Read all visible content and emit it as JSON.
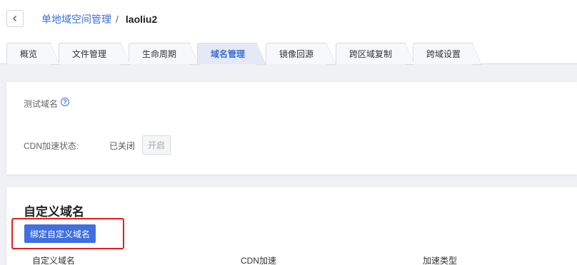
{
  "breadcrumb": {
    "parent": "单地域空间管理",
    "separator": "/",
    "current": "laoliu2"
  },
  "tabs": [
    {
      "label": "概览"
    },
    {
      "label": "文件管理"
    },
    {
      "label": "生命周期"
    },
    {
      "label": "域名管理"
    },
    {
      "label": "镜像回源"
    },
    {
      "label": "跨区域复制"
    },
    {
      "label": "跨域设置"
    }
  ],
  "active_tab": "域名管理",
  "test_domain": {
    "label": "测试域名",
    "help_icon": "question-circle-icon"
  },
  "cdn": {
    "label": "CDN加速状态:",
    "status": "已关闭",
    "enable_label": "开启"
  },
  "custom_domain": {
    "title": "自定义域名",
    "bind_button": "绑定自定义域名",
    "columns": [
      "自定义域名",
      "CDN加速",
      "加速类型"
    ]
  },
  "colors": {
    "accent": "#3a6fd8",
    "button": "#3f6fe0",
    "highlight": "#e02020"
  }
}
